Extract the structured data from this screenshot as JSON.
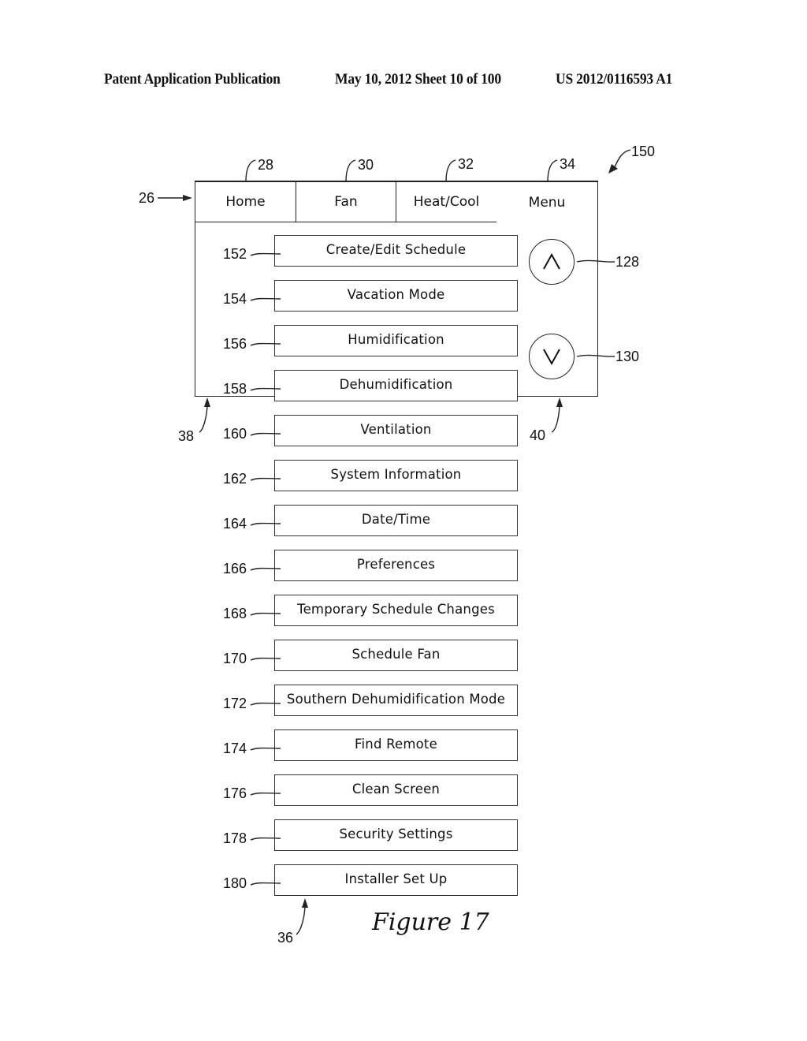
{
  "header": {
    "publication": "Patent Application Publication",
    "date_sheet": "May 10, 2012  Sheet 10 of 100",
    "patent_number": "US 2012/0116593 A1"
  },
  "tabs": [
    {
      "label": "Home",
      "ref": "28"
    },
    {
      "label": "Fan",
      "ref": "30"
    },
    {
      "label": "Heat/Cool",
      "ref": "32"
    },
    {
      "label": "Menu",
      "ref": "34"
    }
  ],
  "menu_items": [
    {
      "label": "Create/Edit Schedule",
      "ref": "152"
    },
    {
      "label": "Vacation Mode",
      "ref": "154"
    },
    {
      "label": "Humidification",
      "ref": "156"
    },
    {
      "label": "Dehumidification",
      "ref": "158"
    },
    {
      "label": "Ventilation",
      "ref": "160"
    },
    {
      "label": "System Information",
      "ref": "162"
    },
    {
      "label": "Date/Time",
      "ref": "164"
    },
    {
      "label": "Preferences",
      "ref": "166"
    },
    {
      "label": "Temporary Schedule Changes",
      "ref": "168"
    },
    {
      "label": "Schedule Fan",
      "ref": "170"
    },
    {
      "label": "Southern Dehumidification Mode",
      "ref": "172"
    },
    {
      "label": "Find Remote",
      "ref": "174"
    },
    {
      "label": "Clean Screen",
      "ref": "176"
    },
    {
      "label": "Security Settings",
      "ref": "178"
    },
    {
      "label": "Installer Set Up",
      "ref": "180"
    }
  ],
  "scroll_buttons": {
    "up": {
      "icon": "chevron-up-icon",
      "ref": "128"
    },
    "down": {
      "icon": "chevron-down-icon",
      "ref": "130"
    }
  },
  "refs": {
    "screen": "150",
    "tab_bar": "26",
    "left_region": "38",
    "right_region": "40",
    "list": "36"
  },
  "figure_caption": "Figure 17"
}
